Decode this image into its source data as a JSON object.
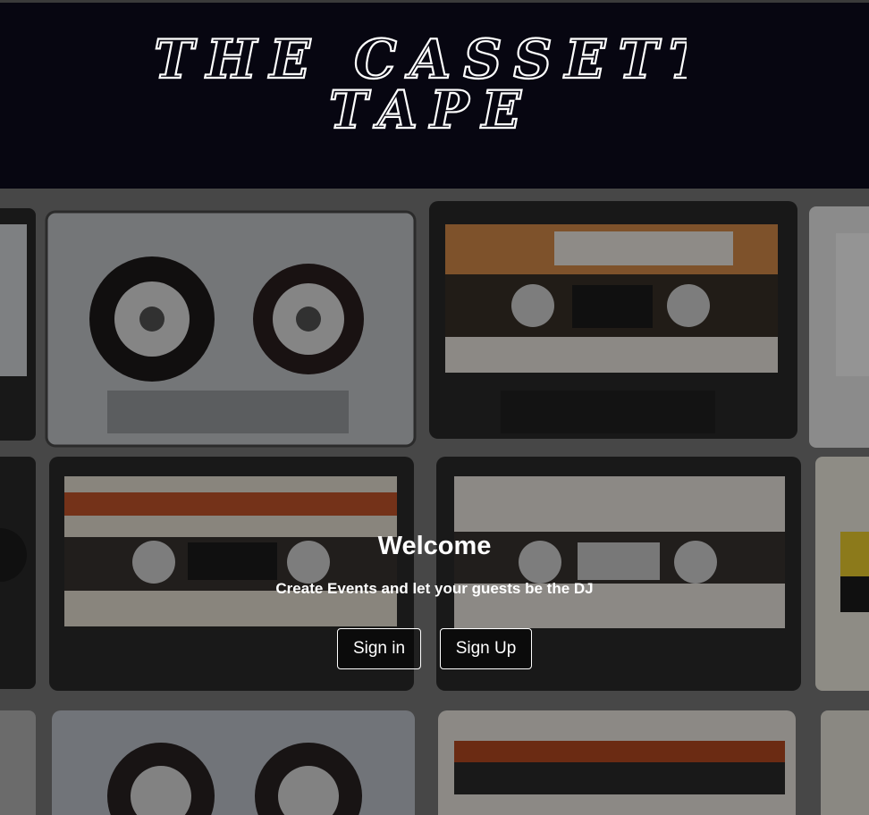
{
  "brand": {
    "line1": "THE CASSETTE",
    "line2": "TAPE"
  },
  "hero": {
    "title": "Welcome",
    "subtitle": "Create Events and let your guests be the DJ",
    "signin_label": "Sign in",
    "signup_label": "Sign Up"
  },
  "colors": {
    "header_bg": "#070611",
    "text": "#ffffff",
    "button_border": "#ffffff"
  }
}
